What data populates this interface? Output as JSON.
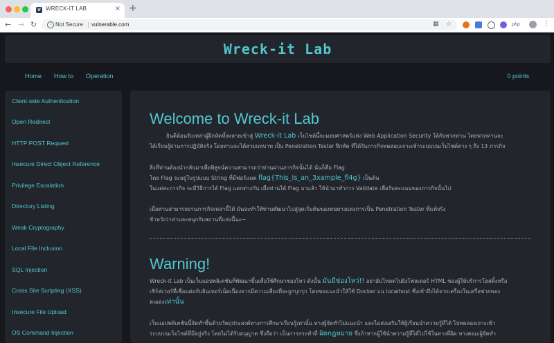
{
  "browser": {
    "tab_title": "WRECK-IT LAB",
    "tab_favicon": "W",
    "close_glyph": "×",
    "new_tab_glyph": "+",
    "security_label": "Not Secure",
    "url": "vulnerable.com",
    "extensions": [
      "translate-icon",
      "star-icon",
      "orange-extension-icon",
      "blue-extension-icon",
      "ghost-extension-icon",
      "circle-extension-icon",
      "php-extension-icon",
      "profile-icon",
      "menu-icon"
    ],
    "php_badge": "php"
  },
  "site": {
    "brand": "Wreck-it Lab",
    "nav": [
      "Home",
      "How to",
      "Operation"
    ],
    "points": "0 points"
  },
  "sidebar": {
    "items": [
      "Client-side Authentication",
      "Open Redirect",
      "HTTP POST Request",
      "Insecure Direct Object Reference",
      "Privilege Escalation",
      "Directory Listing",
      "Weak Cryptography",
      "Local File Inclusion",
      "SQL Injection",
      "Cross Site Scripting (XSS)",
      "Insecure File Upload",
      "OS Command Injection"
    ]
  },
  "content": {
    "welcome_title": "Welcome to Wreck-it Lab",
    "intro": {
      "line1_a": "ยินดีต้อนรับเหล่าผู้ฝึกหัดทั้งหลายเข้าสู่",
      "line1_link": "Wreck-it Lab",
      "line1_b": "เว็บไซต์นี้จะมอบศาสตร์แห่ง Web Application Security ให้กับพวกท่าน โดยพวกท่านจะ",
      "line2": "ได้เรียนรู้ผ่านการปฏิบัติจริง โดยท่านจะได้สวมบทบาท เป็น Penetration Tester ฝึกหัด ที่ได้รับภารกิจทดสอบเจาะเข้าระบบบนเว็บไซต์ต่าง ๆ ถึง 13 ภารกิจ"
    },
    "flag": {
      "line1": "สิ่งที่ท่านต้องนำกลับมาเพื่อพิสูจน์ความสามารถว่าท่านผ่านภารกิจนั้นได้ นั่นก็คือ Flag",
      "line2_a": "โดย Flag จะอยู่ในรูปแบบ String ที่มีฟอร์แมต",
      "line2_code": "flag{This_Is_an_3xample_fl4g}",
      "line2_b": "เป็นต้น",
      "line3": "ในแต่ละภารกิจ จะมีวิธีการได้ Flag แตกต่างกัน เมื่อท่านได้ Flag มาแล้ว ให้นำมาทำการ Validate เพื่อรับคะแนนของภารกิจนั้นไป"
    },
    "closing": {
      "line1": "เมื่อท่านสามารถผ่านภารกิจเหล่านี้ได้ มันจะทำให้ท่านพัฒนาไปสู่จุดเริ่มต้นของหนทางแห่งการเป็น Penetration Tester ที่แท้จริง",
      "line2": "ข้าหวังว่าท่านจะสนุกกับสถานที่แห่งนี้นะ~"
    },
    "warning_title": "Warning!",
    "warning": {
      "line1_a": "Wreck-it Lab เป็นเว็บแอปพลิเคชันที่พัฒนาขึ้นเพื่อใช้ศึกษาช่องโหว่ ดังนั้น",
      "line1_hl": "มันมีช่องโหว่!!",
      "line1_b": "อย่าอัปโหลดไปยังโฟลเดอร์ HTML ของผู้ให้บริการโฮสติ้งหรือ",
      "line2": "เซิร์ฟเวอร์ที่เชื่อมต่อกับอินเทอร์เน็ตเนื่องจากมีความเสี่ยงที่จะถูกบุกรุก โดยขอแนะนำให้ใช้ Docker บน localhost ซึ่งเข้าถึงได้จากเครื่องในเครือข่ายของ",
      "line3_a": "ตนเอง",
      "line3_hl": "เท่านั้น",
      "line4": "เว็บแอปพลิเคชันนี้จัดทำขึ้นด้วยวัตถุประสงค์ทางการศึกษาเรียนรู้เท่านั้น ทางผู้จัดทำไม่แนะนำ และไม่ส่งเสริมให้ผู้เรียนนำความรู้ที่ได้ ไปทดลองเจาะเข้า",
      "line5_a": "ระบบบนเว็บไซต์ที่มีอยู่จริง โดยไม่ได้รับอนุญาต ซึ่งถือว่า เป็นการกระทำที่",
      "line5_hl": "ผิดกฎหมาย",
      "line5_b": "ซึ่งถ้าหากผู้ใช้นำความรู้ที่ได้ไปใช้ในทางที่ผิด ทางคณะผู้จัดทำ"
    }
  }
}
